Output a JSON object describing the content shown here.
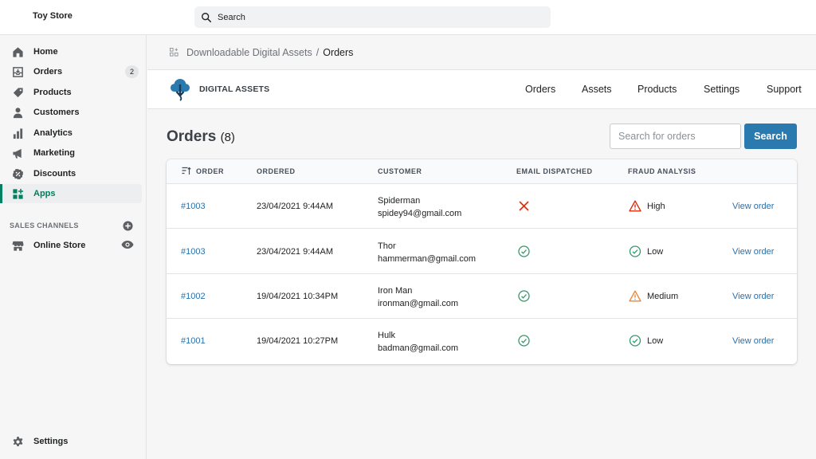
{
  "store": {
    "name": "Toy Store"
  },
  "topbar": {
    "search_placeholder": "Search"
  },
  "sidebar": {
    "items": [
      {
        "label": "Home",
        "icon": "home-icon"
      },
      {
        "label": "Orders",
        "icon": "orders-icon",
        "badge": "2"
      },
      {
        "label": "Products",
        "icon": "tag-icon"
      },
      {
        "label": "Customers",
        "icon": "person-icon"
      },
      {
        "label": "Analytics",
        "icon": "bar-chart-icon"
      },
      {
        "label": "Marketing",
        "icon": "megaphone-icon"
      },
      {
        "label": "Discounts",
        "icon": "discount-icon"
      },
      {
        "label": "Apps",
        "icon": "apps-icon",
        "active": true
      }
    ],
    "sales_channels_title": "SALES CHANNELS",
    "online_store": "Online Store",
    "settings": "Settings"
  },
  "breadcrumb": {
    "parent": "Downloadable Digital Assets",
    "separator": "/",
    "current": "Orders"
  },
  "app": {
    "brand": "DIGITAL ASSETS",
    "nav": [
      "Orders",
      "Assets",
      "Products",
      "Settings",
      "Support"
    ]
  },
  "page": {
    "title": "Orders",
    "count": "(8)",
    "search_placeholder": "Search for orders",
    "search_button": "Search"
  },
  "table": {
    "headers": [
      "ORDER",
      "ORDERED",
      "CUSTOMER",
      "EMAIL DISPATCHED",
      "FRAUD ANALYSIS"
    ],
    "rows": [
      {
        "order": "#1003",
        "ordered": "23/04/2021 9:44AM",
        "customer_name": "Spiderman",
        "customer_email": "spidey94@gmail.com",
        "email_dispatched": false,
        "fraud": "High",
        "action": "View order"
      },
      {
        "order": "#1003",
        "ordered": "23/04/2021 9:44AM",
        "customer_name": "Thor",
        "customer_email": "hammerman@gmail.com",
        "email_dispatched": true,
        "fraud": "Low",
        "action": "View order"
      },
      {
        "order": "#1002",
        "ordered": "19/04/2021 10:34PM",
        "customer_name": "Iron Man",
        "customer_email": "ironman@gmail.com",
        "email_dispatched": true,
        "fraud": "Medium",
        "action": "View order"
      },
      {
        "order": "#1001",
        "ordered": "19/04/2021 10:27PM",
        "customer_name": "Hulk",
        "customer_email": "badman@gmail.com",
        "email_dispatched": true,
        "fraud": "Low",
        "action": "View order"
      }
    ]
  },
  "colors": {
    "accent_green": "#008060",
    "link_blue": "#2a6fa8",
    "button_blue": "#2a7ab0",
    "fraud_high": "#d72c0d",
    "fraud_medium": "#e8873a",
    "fraud_low": "#2e9b6b"
  }
}
